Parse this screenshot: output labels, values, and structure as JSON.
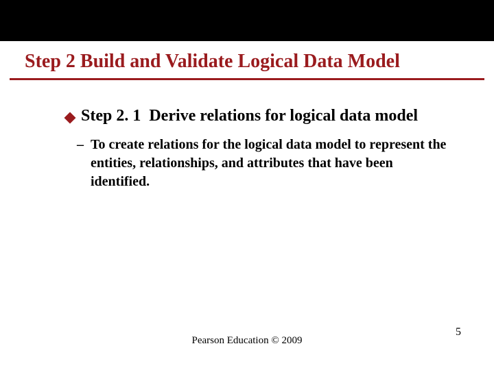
{
  "title": "Step 2 Build and Validate Logical Data Model",
  "bullet": {
    "step": "Step 2. 1",
    "text": "Derive relations for logical data model"
  },
  "sub": {
    "dash": "–",
    "text": "To create relations for the logical data model to represent the entities, relationships, and attributes that have been identified."
  },
  "footer": "Pearson Education © 2009",
  "page": "5"
}
